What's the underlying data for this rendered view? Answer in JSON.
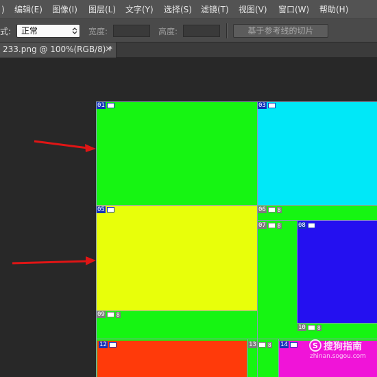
{
  "menu": {
    "items": [
      ")",
      "编辑(E)",
      "图像(I)",
      "图层(L)",
      "文字(Y)",
      "选择(S)",
      "滤镜(T)",
      "视图(V)",
      "窗口(W)",
      "帮助(H)"
    ]
  },
  "options": {
    "style_label": "式:",
    "style_value": "正常",
    "width_label": "宽度:",
    "height_label": "高度:",
    "guides_button": "基于参考线的切片"
  },
  "document_tab": {
    "title": "233.png @ 100%(RGB/8) *",
    "close": "×"
  },
  "colors": {
    "green": "#16f512",
    "cyan": "#00e8f8",
    "yellow": "#e8ff0a",
    "blue": "#2410f0",
    "red": "#ff3a0a",
    "magenta": "#f014d8",
    "slice_label_blue": "#1533b8",
    "arrow_red": "#e01515"
  },
  "slices": [
    {
      "num": "01",
      "auto": false
    },
    {
      "num": "03",
      "auto": false
    },
    {
      "num": "05",
      "auto": false
    },
    {
      "num": "06",
      "auto": true
    },
    {
      "num": "07",
      "auto": true
    },
    {
      "num": "08",
      "auto": false
    },
    {
      "num": "09",
      "auto": true
    },
    {
      "num": "10",
      "auto": true
    },
    {
      "num": "12",
      "auto": false
    },
    {
      "num": "13",
      "auto": true
    },
    {
      "num": "14",
      "auto": false
    }
  ],
  "watermark": {
    "text": "搜狗指南",
    "url": "zhinan.sogou.com"
  }
}
